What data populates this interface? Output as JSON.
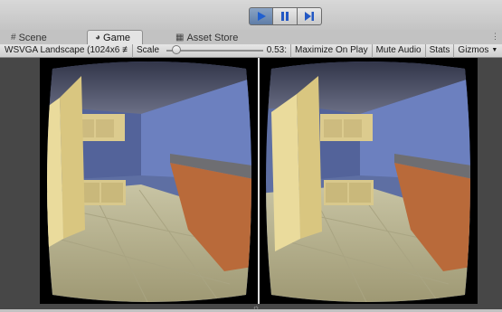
{
  "toolbar_top": {
    "buttons": [
      {
        "name": "play-button",
        "icon": "play-icon",
        "active": true
      },
      {
        "name": "pause-button",
        "icon": "pause-icon",
        "active": false
      },
      {
        "name": "step-button",
        "icon": "step-icon",
        "active": false
      }
    ]
  },
  "tabs": [
    {
      "label": "Scene",
      "icon": "grid-icon"
    },
    {
      "label": "Game",
      "icon": "pacman-icon"
    },
    {
      "label": "Asset Store",
      "icon": "store-icon"
    }
  ],
  "game_toolbar": {
    "resolution": "WSVGA Landscape (1024x6 ≢",
    "scale_label": "Scale",
    "scale_value": "0.53:",
    "scale_fraction": 0.05,
    "maximize_label": "Maximize On Play",
    "mute_label": "Mute Audio",
    "stats_label": "Stats",
    "gizmos_label": "Gizmos"
  },
  "colors": {
    "active_button": "#5f7ea8",
    "wall": "#5e6fa3",
    "floor": "#b3ad8a",
    "cabinet": "#d8c88c",
    "counter": "#b96a3a"
  }
}
